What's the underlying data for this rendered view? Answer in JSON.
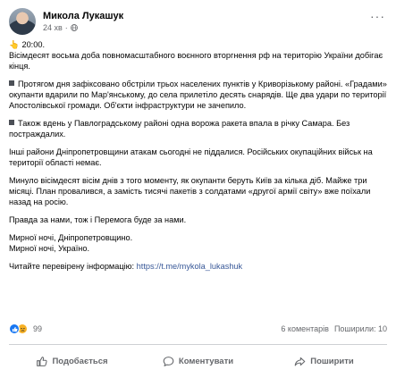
{
  "post": {
    "author": "Микола Лукашук",
    "time": "24 хв",
    "time_sep": "·",
    "more": "···"
  },
  "content": {
    "intro_emoji": "👆",
    "time_label": "20:00.",
    "p1": "Вісімдесят восьма доба повномасштабного воєнного вторгнення рф на територію України добігає кінця.",
    "p2": "Протягом дня зафіксовано обстріли трьох населених пунктів у Криворізькому районі. «Градами» окупанти вдарили по Мар'янському, до села прилетіло десять снарядів. Ще два удари по території Апостолівської громади. Об'єкти інфраструктури не зачепило.",
    "p3": "Також вдень у Павлоградському районі одна ворожа ракета впала в річку Самара. Без постраждалих.",
    "p4": "Інші райони Дніпропетровщини атакам сьогодні не піддалися. Російських окупаційних військ на території області немає.",
    "p5": "Минуло вісімдесят вісім днів з того моменту, як окупанти беруть Київ за кілька діб. Майже три місяці. План провалився, а замість тисячі пакетів з солдатами «другої армії світу» вже поїхали назад на росію.",
    "p6": "Правда за нами, тож і Перемога буде за нами.",
    "p7a": "Мирної ночі, Дніпропетровщино.",
    "p7b": "Мирної ночі, Україно.",
    "p8_prefix": "Читайте перевірену інформацію:",
    "p8_link": "https://t.me/mykola_lukashuk"
  },
  "stats": {
    "reactions_count": "99",
    "comments": "6 коментарів",
    "shares": "Поширили: 10"
  },
  "actions": {
    "like": "Подобається",
    "comment": "Коментувати",
    "share": "Поширити"
  },
  "colors": {
    "like_blue": "#1877f2",
    "sad_yellow": "#f7b125",
    "link": "#385898",
    "muted": "#65676b"
  }
}
